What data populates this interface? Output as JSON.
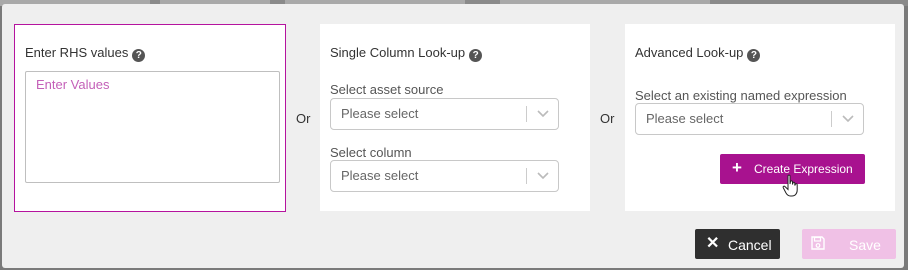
{
  "rhs_panel": {
    "title": "Enter RHS values",
    "help_icon": "question-circle-icon",
    "textarea_placeholder": "Enter Values"
  },
  "separator_1": "Or",
  "single_lookup": {
    "title": "Single Column Look-up",
    "help_icon": "question-circle-icon",
    "asset_source_label": "Select asset source",
    "asset_source_value": "Please select",
    "column_label": "Select column",
    "column_value": "Please select"
  },
  "separator_2": "Or",
  "advanced_lookup": {
    "title": "Advanced Look-up",
    "help_icon": "question-circle-icon",
    "expression_label": "Select an existing named expression",
    "expression_value": "Please select",
    "create_button": "Create Expression",
    "create_icon": "plus-icon"
  },
  "footer": {
    "cancel_label": "Cancel",
    "cancel_icon": "close-icon",
    "save_label": "Save",
    "save_icon": "floppy-disk-icon"
  },
  "colors": {
    "accent": "#a8128f",
    "accent_disabled": "#f0c1e6",
    "dark_button": "#2f2f2f",
    "modal_bg": "#efefef"
  }
}
